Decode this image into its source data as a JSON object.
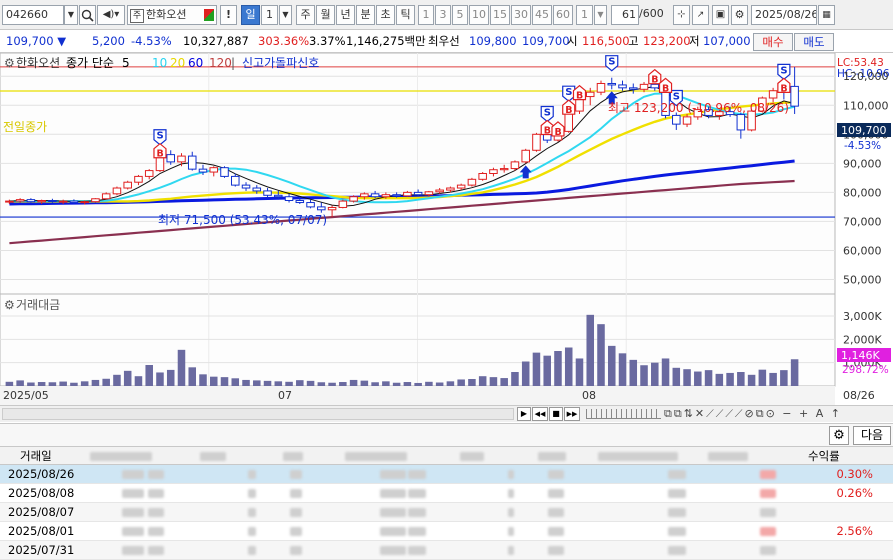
{
  "toolbar": {
    "code": "042660",
    "name": "한화오션",
    "name_badge": "주",
    "buttons": [
      "!",
      "일",
      "1",
      "주",
      "월",
      "년",
      "분",
      "초",
      "틱"
    ],
    "periods": [
      "1",
      "3",
      "5",
      "10",
      "15",
      "30",
      "45",
      "60",
      "1"
    ],
    "count": "61",
    "count_total": "/600",
    "date": "2025/08/26"
  },
  "quote": {
    "price": "109,700 ▼",
    "change": "5,200",
    "change_pct": "-4.53%",
    "volume": "10,327,887",
    "volume_ratio": "303.36%",
    "turnover_ratio": "3.37%",
    "amount": "1,146,275백만",
    "best_label": "최우선",
    "bid1": "109,800",
    "bid2": "109,700",
    "open_label": "시",
    "open": "116,500",
    "high_label": "고",
    "high": "123,200",
    "low_label": "저",
    "low": "107,000",
    "buy_btn": "매수",
    "sell_btn": "매도"
  },
  "chart": {
    "legend_name": "한화오션",
    "legend_items": [
      {
        "label": "종가 단순",
        "color": "#000000"
      },
      {
        "label": "5",
        "color": "#000000"
      },
      {
        "label": "10",
        "color": "#2ad4f0"
      },
      {
        "label": "20",
        "color": "#e8d800"
      },
      {
        "label": "60",
        "color": "#0000e0"
      },
      {
        "label": "120",
        "color": "#c04040"
      }
    ],
    "signal_label": "신고가돌파신호",
    "lc": "LC:53.43",
    "hc": "HC:-10.96",
    "price_ticks": [
      "120,000",
      "110,000",
      "100,000",
      "90,000",
      "80,000",
      "70,000",
      "60,000",
      "50,000"
    ],
    "current_price": "109,700",
    "current_pct": "-4.53%",
    "prev_close_label": "전일종가",
    "high_annotation": "최고 123,200 (-10.96%, 08/26)",
    "low_annotation": "최저 71,500 (53.43%, 07/07)",
    "volume_label": "거래대금",
    "volume_ticks": [
      "3,000K",
      "2,000K",
      "1,000K"
    ],
    "current_volume": "1,146K",
    "current_volume_pct": "298.72%",
    "x_labels": [
      "2025/05",
      "07",
      "08",
      "08/26"
    ],
    "signal_badges": [
      "S",
      "S",
      "S",
      "S",
      "S",
      "S"
    ],
    "buy_badges": [
      "B",
      "B",
      "B",
      "B",
      "B",
      "B",
      "B",
      "B"
    ]
  },
  "chart_data": {
    "type": "candlestick",
    "price_range": [
      45000,
      128000
    ],
    "volume_range": [
      0,
      3600
    ],
    "candles": [
      [
        77000,
        77500,
        76000,
        77000
      ],
      [
        77000,
        78000,
        76500,
        77500
      ],
      [
        77500,
        78000,
        76500,
        76800
      ],
      [
        76800,
        77500,
        76000,
        77200
      ],
      [
        77200,
        77800,
        76500,
        76900
      ],
      [
        76900,
        77500,
        76000,
        77000
      ],
      [
        77000,
        77600,
        76200,
        76500
      ],
      [
        76500,
        77200,
        75800,
        76800
      ],
      [
        76800,
        78000,
        76500,
        77800
      ],
      [
        77800,
        80000,
        77500,
        79500
      ],
      [
        79500,
        82000,
        79000,
        81500
      ],
      [
        81500,
        84000,
        81000,
        83500
      ],
      [
        83500,
        86000,
        82500,
        85500
      ],
      [
        85500,
        88000,
        84500,
        87500
      ],
      [
        87500,
        94000,
        87000,
        93000
      ],
      [
        93000,
        94500,
        89500,
        90500
      ],
      [
        90500,
        93500,
        89000,
        92500
      ],
      [
        92500,
        94000,
        87500,
        88000
      ],
      [
        88000,
        89500,
        86000,
        87000
      ],
      [
        87000,
        89000,
        85500,
        88500
      ],
      [
        88500,
        89000,
        85000,
        85500
      ],
      [
        85500,
        86500,
        82000,
        82500
      ],
      [
        82500,
        83500,
        80500,
        81500
      ],
      [
        81500,
        82500,
        79500,
        80500
      ],
      [
        80500,
        81500,
        78000,
        79000
      ],
      [
        79000,
        80500,
        77500,
        78500
      ],
      [
        78500,
        79500,
        76500,
        77200
      ],
      [
        77200,
        78500,
        76000,
        76500
      ],
      [
        76500,
        77500,
        74500,
        75000
      ],
      [
        75000,
        76500,
        73000,
        74000
      ],
      [
        74000,
        75500,
        71500,
        74800
      ],
      [
        74800,
        77500,
        74500,
        77000
      ],
      [
        77000,
        79000,
        76500,
        78500
      ],
      [
        78500,
        80000,
        77500,
        79500
      ],
      [
        79500,
        80500,
        78000,
        78500
      ],
      [
        78500,
        80000,
        77800,
        79200
      ],
      [
        79200,
        80000,
        78200,
        78800
      ],
      [
        78800,
        80500,
        78500,
        80000
      ],
      [
        80000,
        81000,
        78800,
        79200
      ],
      [
        79200,
        80500,
        78500,
        80200
      ],
      [
        80200,
        81500,
        79500,
        80800
      ],
      [
        80800,
        82000,
        80000,
        81500
      ],
      [
        81500,
        83000,
        80800,
        82500
      ],
      [
        82500,
        85000,
        82000,
        84500
      ],
      [
        84500,
        87000,
        84000,
        86500
      ],
      [
        86500,
        88500,
        85500,
        87800
      ],
      [
        87800,
        89500,
        86800,
        88200
      ],
      [
        88200,
        91000,
        87500,
        90500
      ],
      [
        90500,
        95000,
        90000,
        94500
      ],
      [
        94500,
        100500,
        94000,
        100000
      ],
      [
        100000,
        102000,
        97000,
        98000
      ],
      [
        98000,
        101500,
        97500,
        101000
      ],
      [
        101000,
        109000,
        100500,
        108000
      ],
      [
        108000,
        114000,
        107000,
        113000
      ],
      [
        113000,
        116000,
        110000,
        114500
      ],
      [
        114500,
        118500,
        113500,
        117500
      ],
      [
        117500,
        119500,
        115500,
        117000
      ],
      [
        117000,
        118500,
        115000,
        116000
      ],
      [
        116000,
        117500,
        114000,
        115500
      ],
      [
        115500,
        118000,
        114500,
        117200
      ],
      [
        117200,
        119500,
        115000,
        116000
      ],
      [
        116000,
        116500,
        105500,
        106500
      ],
      [
        106500,
        107500,
        101500,
        103500
      ],
      [
        103500,
        107000,
        102500,
        106000
      ],
      [
        106000,
        109500,
        105000,
        108500
      ],
      [
        108500,
        109500,
        105500,
        106500
      ],
      [
        106500,
        108500,
        105000,
        107800
      ],
      [
        107800,
        109500,
        106000,
        106800
      ],
      [
        106800,
        107500,
        98500,
        101500
      ],
      [
        101500,
        108500,
        101000,
        108000
      ],
      [
        108000,
        113000,
        107500,
        112500
      ],
      [
        112500,
        116000,
        111000,
        115000
      ],
      [
        115000,
        116500,
        112000,
        114500
      ],
      [
        116500,
        123200,
        107000,
        109700
      ]
    ],
    "volumes": [
      180,
      240,
      150,
      170,
      160,
      190,
      140,
      200,
      260,
      310,
      480,
      650,
      420,
      900,
      580,
      690,
      1550,
      800,
      500,
      400,
      380,
      330,
      260,
      240,
      220,
      200,
      180,
      250,
      220,
      160,
      140,
      170,
      260,
      230,
      160,
      200,
      140,
      170,
      130,
      180,
      150,
      200,
      280,
      300,
      420,
      380,
      340,
      600,
      1050,
      1430,
      1300,
      1500,
      1650,
      1180,
      3050,
      2650,
      1720,
      1400,
      1120,
      890,
      1000,
      1180,
      780,
      720,
      620,
      680,
      520,
      560,
      600,
      480,
      700,
      560,
      680,
      1146
    ],
    "ma5": [
      77000,
      77100,
      77100,
      77200,
      77100,
      77000,
      76900,
      76900,
      77100,
      77600,
      78500,
      79900,
      81700,
      83800,
      86500,
      88200,
      89800,
      90300,
      90000,
      89400,
      88300,
      86400,
      84800,
      83300,
      81900,
      80700,
      79600,
      78600,
      77600,
      76600,
      75600,
      75200,
      75500,
      76400,
      77600,
      78500,
      78900,
      79200,
      79100,
      79200,
      79600,
      80100,
      80800,
      81600,
      82700,
      84100,
      85800,
      87500,
      89900,
      92600,
      95100,
      97200,
      99800,
      104000,
      108100,
      111000,
      113400,
      114600,
      115300,
      115900,
      116400,
      114600,
      111700,
      109000,
      107200,
      106000,
      106100,
      107000,
      106300,
      105600,
      106900,
      109700,
      111500,
      110500
    ],
    "ma10": [
      77000,
      77000,
      77000,
      77000,
      77000,
      77000,
      77000,
      77000,
      77000,
      77100,
      77600,
      78400,
      79300,
      80400,
      81600,
      83000,
      84600,
      86000,
      86900,
      87700,
      88200,
      88200,
      87800,
      87000,
      86000,
      84800,
      83500,
      82100,
      80800,
      79500,
      78300,
      77500,
      77000,
      76700,
      76600,
      76600,
      76700,
      77000,
      77500,
      78000,
      78500,
      79000,
      79600,
      80300,
      81100,
      82200,
      83400,
      84700,
      86300,
      88100,
      90100,
      92200,
      94200,
      96600,
      99000,
      102000,
      105300,
      108000,
      110700,
      112900,
      114000,
      114100,
      113500,
      112100,
      110700,
      109500,
      108400,
      107400,
      107000,
      106800,
      107000,
      107500,
      108600,
      109500
    ],
    "ma20": [
      76900,
      76900,
      76900,
      76900,
      76900,
      76900,
      76900,
      76900,
      76900,
      76900,
      76900,
      76900,
      77000,
      77200,
      77500,
      77800,
      78200,
      78600,
      78900,
      79200,
      79500,
      79700,
      79900,
      80000,
      80000,
      79900,
      79800,
      79600,
      79300,
      79000,
      78700,
      78400,
      78100,
      78000,
      78000,
      78000,
      78000,
      78000,
      78100,
      78200,
      78400,
      78700,
      79000,
      79500,
      80000,
      80800,
      81700,
      82700,
      83900,
      85300,
      87000,
      88800,
      90800,
      92800,
      94700,
      96600,
      98400,
      100000,
      101500,
      103000,
      104300,
      105400,
      106200,
      106800,
      107400,
      108000,
      108600,
      109100,
      109500,
      109900,
      110300,
      110600,
      110900,
      111000
    ],
    "ma60": [
      76000,
      76050,
      76100,
      76150,
      76200,
      76250,
      76300,
      76350,
      76400,
      76450,
      76500,
      76600,
      76700,
      76800,
      76900,
      77000,
      77100,
      77200,
      77300,
      77400,
      77500,
      77600,
      77700,
      77800,
      77900,
      78000,
      78050,
      78100,
      78150,
      78200,
      78250,
      78300,
      78350,
      78400,
      78450,
      78500,
      78550,
      78600,
      78650,
      78700,
      78800,
      78900,
      79000,
      79100,
      79200,
      79300,
      79400,
      79500,
      79600,
      79800,
      80100,
      80500,
      81000,
      81600,
      82200,
      82800,
      83400,
      84000,
      84500,
      85000,
      85500,
      86000,
      86400,
      86800,
      87200,
      87600,
      88000,
      88400,
      88800,
      89200,
      89600,
      90000,
      90400,
      90800
    ],
    "ma120": [
      62500,
      62800,
      63100,
      63400,
      63700,
      64000,
      64300,
      64600,
      64900,
      65200,
      65500,
      65800,
      66100,
      66400,
      66700,
      67000,
      67300,
      67600,
      67900,
      68200,
      68500,
      68800,
      69100,
      69400,
      69700,
      70000,
      70300,
      70600,
      70900,
      71200,
      71500,
      71800,
      72100,
      72400,
      72700,
      73000,
      73300,
      73600,
      73900,
      74200,
      74500,
      74800,
      75100,
      75400,
      75700,
      76000,
      76300,
      76600,
      76900,
      77200,
      77500,
      77800,
      78100,
      78400,
      78700,
      79000,
      79300,
      79600,
      79900,
      80200,
      80500,
      80800,
      81100,
      81400,
      81700,
      82000,
      82300,
      82600,
      82900,
      83100,
      83300,
      83500,
      83700,
      83900
    ],
    "prev_close": 114900,
    "low_line": 71500,
    "high_line": 123200
  },
  "bottombar": {
    "nav_buttons": [
      "▶",
      "◀◀",
      "■",
      "▶▶"
    ]
  },
  "grid": {
    "next_btn": "다음",
    "headers": [
      "거래일",
      "수익률"
    ],
    "rows": [
      {
        "date": "2025/08/26",
        "ret": "0.30%",
        "highlight": true
      },
      {
        "date": "2025/08/08",
        "ret": "0.26%",
        "highlight": false
      },
      {
        "date": "2025/08/07",
        "ret": "",
        "highlight": false
      },
      {
        "date": "2025/08/01",
        "ret": "2.56%",
        "highlight": false
      },
      {
        "date": "2025/07/31",
        "ret": "",
        "highlight": false
      }
    ]
  },
  "colors": {
    "up": "#e02020",
    "down": "#1030d0",
    "accent": "#3a78d0",
    "chart_bg": "#ffffff",
    "volume_bar": "#6a6aa0"
  }
}
